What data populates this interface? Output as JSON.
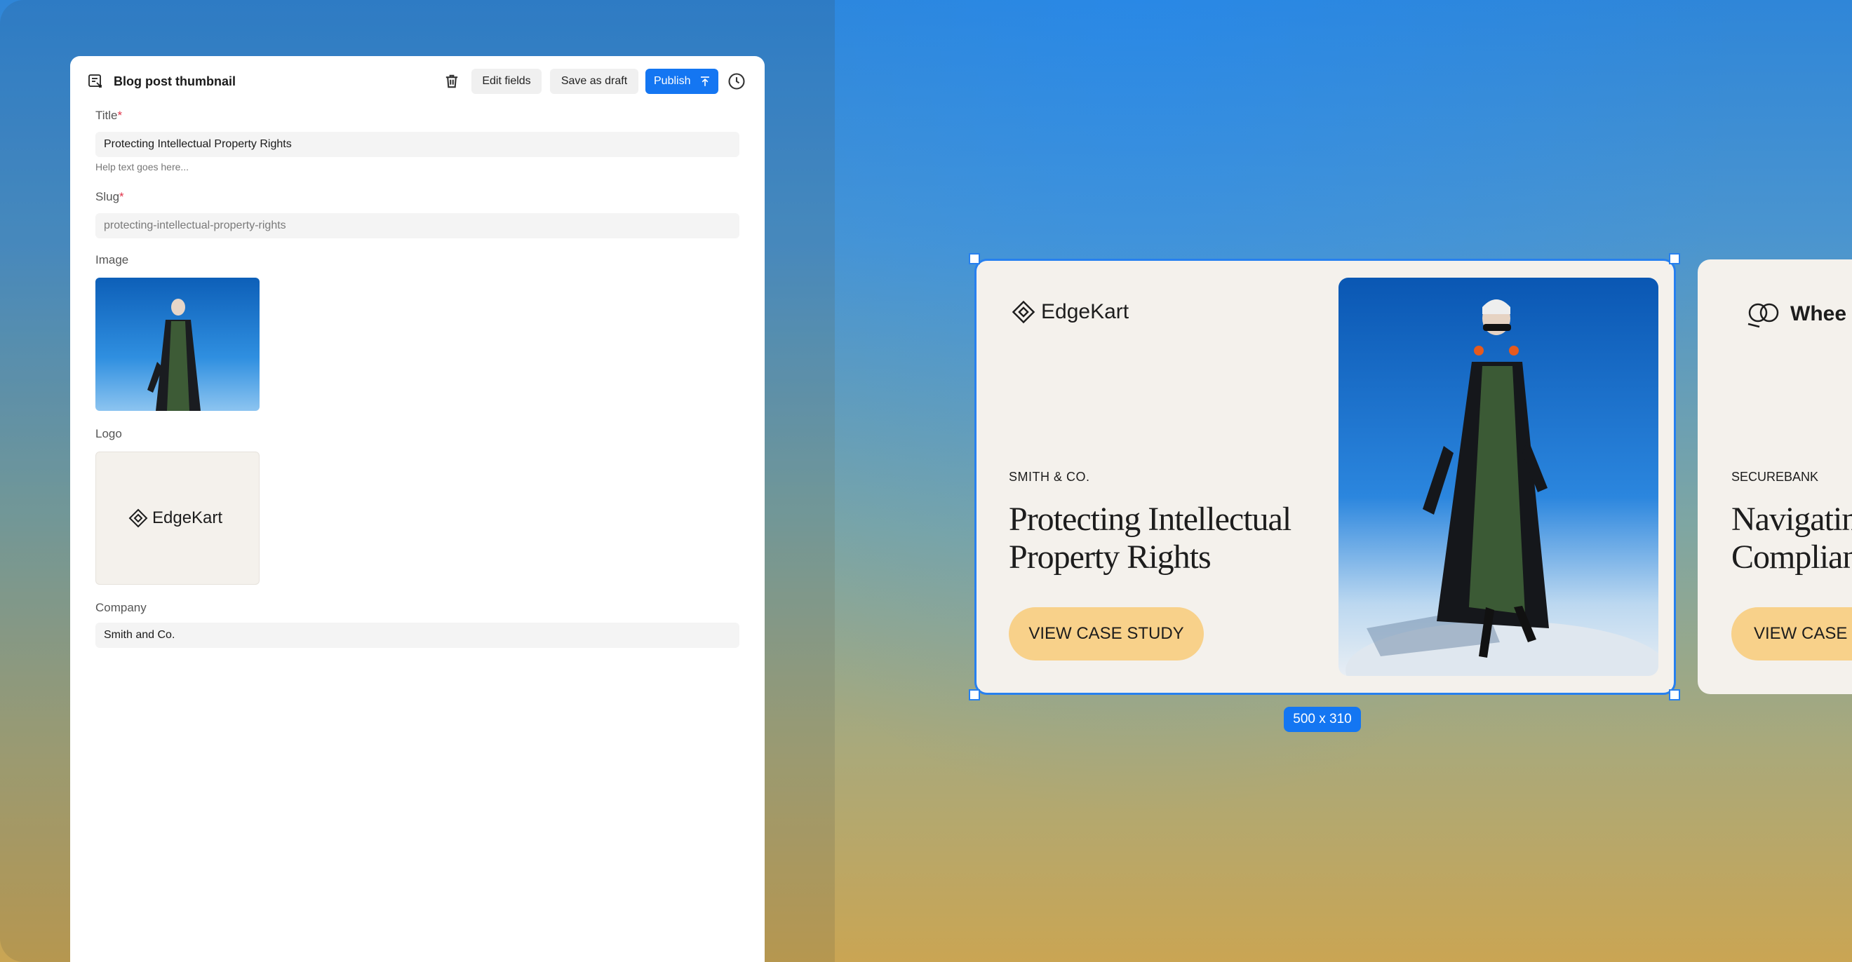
{
  "editor": {
    "title": "Blog post thumbnail",
    "edit_fields_label": "Edit fields",
    "save_draft_label": "Save as draft",
    "publish_label": "Publish",
    "fields": {
      "title_label": "Title",
      "title_value": "Protecting Intellectual Property Rights",
      "title_help": "Help text goes here...",
      "slug_label": "Slug",
      "slug_value": "protecting-intellectual-property-rights",
      "image_label": "Image",
      "logo_label": "Logo",
      "logo_text": "EdgeKart",
      "company_label": "Company",
      "company_value": "Smith and Co."
    },
    "required_mark": "*"
  },
  "canvas": {
    "card": {
      "logo_text": "EdgeKart",
      "company": "SMITH & CO.",
      "title": "Protecting Intellectual Property Rights",
      "cta": "VIEW CASE STUDY"
    },
    "dimensions_badge": "500 x 310",
    "next_card": {
      "logo_text": "Whee",
      "company": "SECUREBANK",
      "title_line1": "Navigating",
      "title_line2": "Complianc",
      "cta": "VIEW CASE S"
    }
  },
  "colors": {
    "accent": "#1476f2",
    "cta": "#f8d18a",
    "card_bg": "#f4f1ec"
  }
}
